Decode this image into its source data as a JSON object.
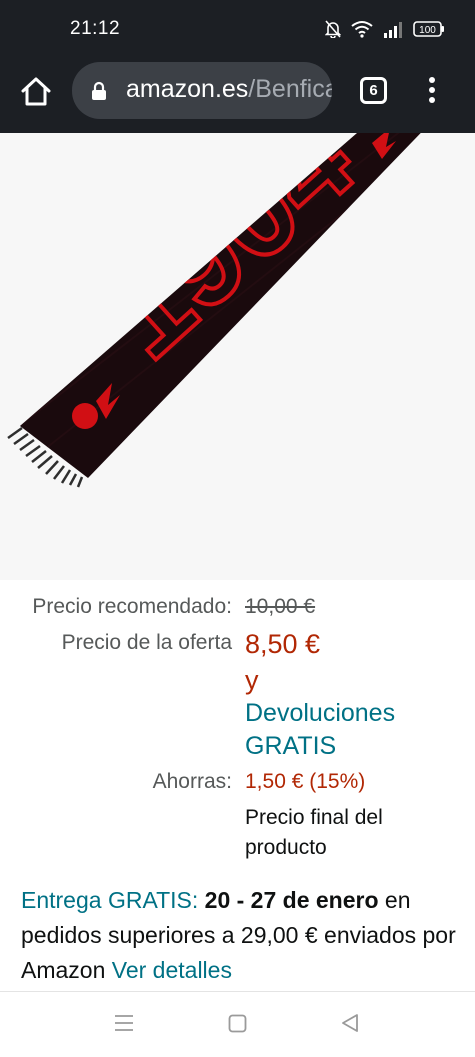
{
  "status_bar": {
    "time": "21:12",
    "battery": "100"
  },
  "browser": {
    "url_domain": "amazon.es",
    "url_path": "/Benfica-Bufanda",
    "tab_count": "6"
  },
  "pricing": {
    "list_label": "Precio recomendado:",
    "list_price": "10,00 €",
    "deal_label": "Precio de la oferta",
    "deal_price": "8,50 €",
    "deal_conjunction": "y",
    "returns_line1": "Devoluciones",
    "returns_line2": "GRATIS",
    "savings_label": "Ahorras:",
    "savings_value": "1,50 € (15%)",
    "final_note_line1": "Precio final del",
    "final_note_line2": "producto"
  },
  "delivery": {
    "free_label": "Entrega GRATIS:",
    "dates": "20 - 27 de enero",
    "text_1": " en pedidos superiores a 29,00 € enviados por Amazon ",
    "details_link": "Ver detalles"
  },
  "scarf": {
    "year_text": "1904",
    "primary_color": "#d10f14",
    "base_color": "#1a0a0d"
  },
  "colors": {
    "chrome": "#1c1f24",
    "price_red": "#b12704",
    "link_teal": "#007185"
  }
}
